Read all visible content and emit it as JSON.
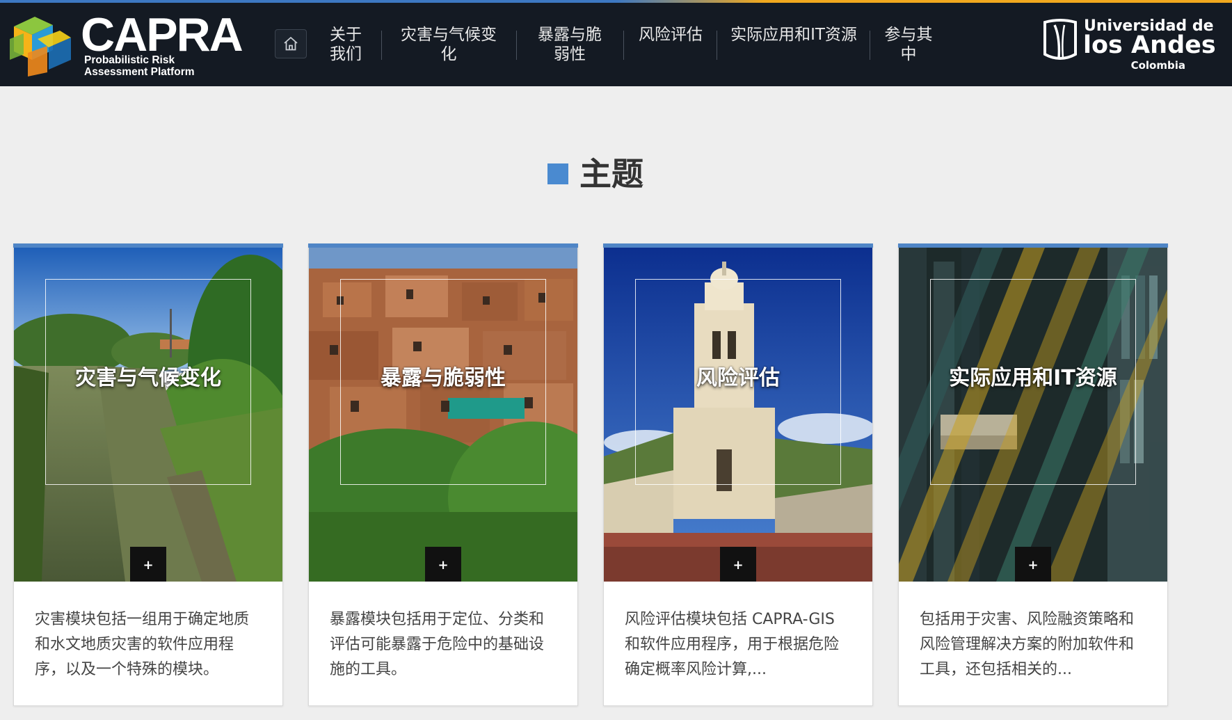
{
  "header": {
    "logo": {
      "title": "CAPRA",
      "subtitle_line1": "Probabilistic Risk",
      "subtitle_line2": "Assessment Platform"
    },
    "home_icon": "home-icon",
    "nav": [
      {
        "line1": "关于",
        "line2": "我们"
      },
      {
        "line1": "灾害与气候变",
        "line2": "化"
      },
      {
        "line1": "暴露与脆",
        "line2": "弱性"
      },
      {
        "line1": "风险评估",
        "line2": ""
      },
      {
        "line1": "实际应用和IT资源",
        "line2": ""
      },
      {
        "line1": "参与其",
        "line2": "中"
      }
    ],
    "university": {
      "line1": "Universidad de",
      "line2": "los Andes",
      "line3": "Colombia"
    }
  },
  "section": {
    "title": "主题"
  },
  "cards": [
    {
      "title": "灾害与气候变化",
      "plus": "+",
      "description": "灾害模块包括一组用于确定地质和水文地质灾害的软件应用程序，以及一个特殊的模块。"
    },
    {
      "title": "暴露与脆弱性",
      "plus": "+",
      "description": "暴露模块包括用于定位、分类和评估可能暴露于危险中的基础设施的工具。"
    },
    {
      "title": "风险评估",
      "plus": "+",
      "description": "风险评估模块包括 CAPRA-GIS 和软件应用程序，用于根据危险确定概率风险计算,..."
    },
    {
      "title": "实际应用和IT资源",
      "plus": "+",
      "description": "包括用于灾害、风险融资策略和风险管理解决方案的附加软件和工具，还包括相关的..."
    }
  ],
  "colors": {
    "header_bg": "#141a23",
    "accent_blue": "#4f85c6",
    "accent_orange": "#f0a81e",
    "page_bg": "#eeeeee"
  }
}
